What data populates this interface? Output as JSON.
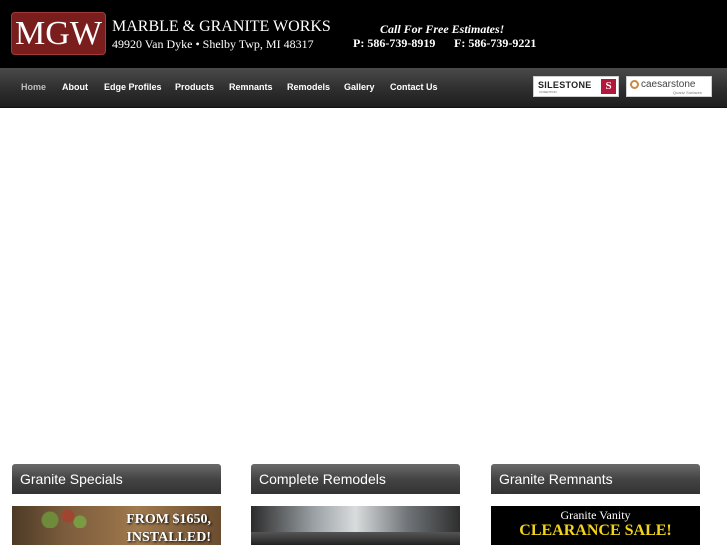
{
  "header": {
    "logo_text": "MGW",
    "company_name": "MARBLE & GRANITE WORKS",
    "address": "49920 Van Dyke • Shelby Twp, MI 48317",
    "tagline": "Call For Free Estimates!",
    "phone": "P: 586-739-8919",
    "fax": "F: 586-739-9221"
  },
  "nav": {
    "items": [
      "Home",
      "About",
      "Edge Profiles",
      "Products",
      "Remnants",
      "Remodels",
      "Gallery",
      "Contact Us"
    ],
    "active": "Home"
  },
  "partners": {
    "silestone": {
      "name": "SILESTONE",
      "sub": "COSENTINO",
      "mark": "S"
    },
    "caesarstone": {
      "name": "caesarstone",
      "sub": "Quartz Surfaces"
    }
  },
  "panels": [
    {
      "title": "Granite Specials",
      "promo_line1": "FROM $1650,",
      "promo_line2": "INSTALLED!"
    },
    {
      "title": "Complete Remodels"
    },
    {
      "title": "Granite Remnants",
      "promo_line1": "Granite Vanity",
      "promo_line2": "CLEARANCE SALE!"
    }
  ],
  "colors": {
    "header_bg": "#000000",
    "logo_bg": "#7a1d1d",
    "silestone_red": "#b3173a",
    "clearance_yellow": "#f2d41b"
  }
}
